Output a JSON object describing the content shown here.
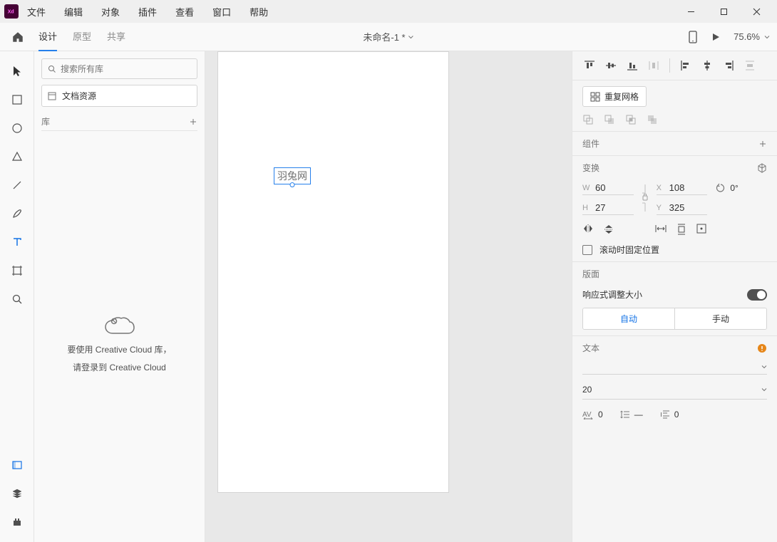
{
  "menu": {
    "file": "文件",
    "edit": "编辑",
    "object": "对象",
    "plugin": "插件",
    "view": "查看",
    "window": "窗口",
    "help": "帮助"
  },
  "tabs": {
    "design": "设计",
    "prototype": "原型",
    "share": "共享"
  },
  "doc": {
    "title": "未命名-1 *"
  },
  "zoom": {
    "value": "75.6%"
  },
  "leftpanel": {
    "search_placeholder": "搜索所有库",
    "doc_resources": "文档资源",
    "lib": "库",
    "cc_line1": "要使用 Creative Cloud 库，",
    "cc_line2": "请登录到 Creative Cloud"
  },
  "canvas": {
    "text": "羽兔网"
  },
  "right": {
    "repeat_grid": "重复网格",
    "component": "组件",
    "transform": "变换",
    "W": "60",
    "H": "27",
    "X": "108",
    "Y": "325",
    "rot": "0°",
    "scroll_fix": "滚动时固定位置",
    "layout": "版面",
    "responsive": "响应式调整大小",
    "auto": "自动",
    "manual": "手动",
    "text": "文本",
    "fontsize": "20",
    "charsp": "0",
    "linesp": "—",
    "parasp": "0"
  }
}
